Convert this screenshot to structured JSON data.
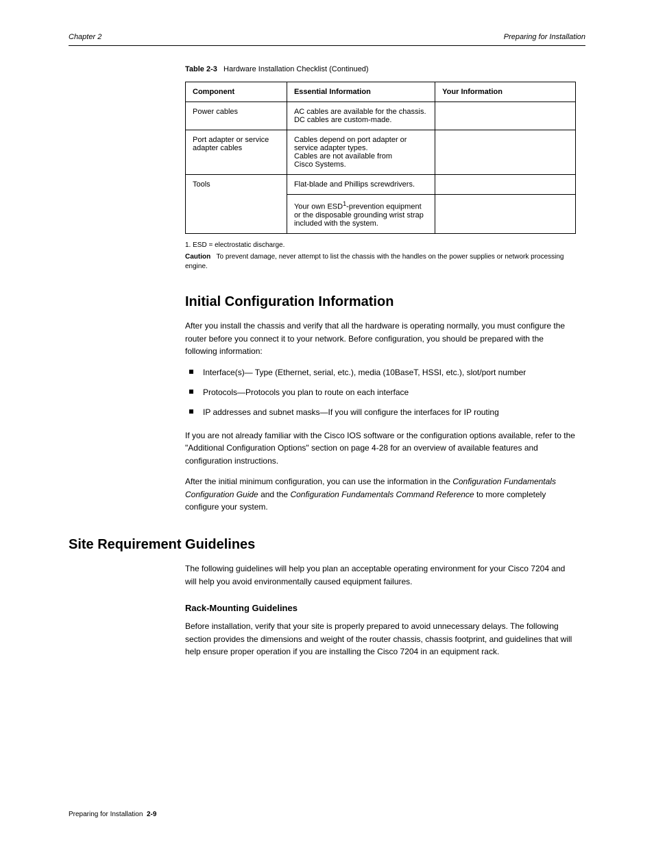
{
  "header": {
    "left": "Chapter 2",
    "right": "Preparing for Installation"
  },
  "table": {
    "number": "Table 2-3",
    "title": "Hardware Installation Checklist (Continued)",
    "columns": [
      "Component",
      "Essential Information",
      "Your Information"
    ],
    "rows": [
      {
        "component": "Power cables",
        "info_html": "AC cables are available for the chassis.<br>DC cables are custom-made.",
        "your": ""
      },
      {
        "component": "Port adapter or service adapter cables",
        "info_html": "Cables depend on port adapter or service adapter types.<br>Cables are not available from Cisco Systems.",
        "your": ""
      },
      {
        "component": "Tools (rowspan 2)",
        "info_html": "Flat-blade and Phillips screwdrivers.",
        "your": ""
      },
      {
        "component": "(merged)",
        "info_html": "Your own ESD<sup>1</sup>-prevention equipment or the disposable grounding wrist strap included with the system.",
        "your": ""
      }
    ],
    "footnote": "1.    ESD = electrostatic discharge.",
    "caution": "Caution   To prevent damage, never attempt to list the chassis with the handles on the power supplies or network processing engine."
  },
  "sections": {
    "initial": {
      "title": "Initial Configuration Information",
      "intro": "After you install the chassis and verify that all the hardware is operating normally, you must configure the router before you connect it to your network. Before configuration, you should be prepared with the following information:",
      "bullets": [
        "Interface(s)— Type (Ethernet, serial, etc.), media (10BaseT, HSSI, etc.), slot/port number",
        "Protocols—Protocols you plan to route on each interface",
        "IP addresses and subnet masks—If you will configure the interfaces for IP routing"
      ],
      "initial_p1": "If you are not already familiar with the Cisco IOS software or the configuration options available, refer to the \"Additional Configuration Options\" section on page 4-28 for an overview of available features and configuration instructions.",
      "initial_p2": "After the initial minimum configuration, you can use the information in the Configuration Fundamentals Configuration Guide and the Configuration Fundamentals Command Reference to more completely configure your system."
    },
    "site": {
      "title": "Site Requirement Guidelines",
      "intro": "The following guidelines will help you plan an acceptable operating environment for your Cisco 7204 and will help you avoid environmentally caused equipment failures.",
      "rack": {
        "title": "Rack-Mounting Guidelines",
        "p": "Before installation, verify that your site is properly prepared to avoid unnecessary delays. The following section provides the dimensions and weight of the router chassis, chassis footprint, and guidelines that will help ensure proper operation if you are installing the Cisco 7204 in an equipment rack."
      }
    }
  },
  "footer": "Preparing for Installation  2-9"
}
